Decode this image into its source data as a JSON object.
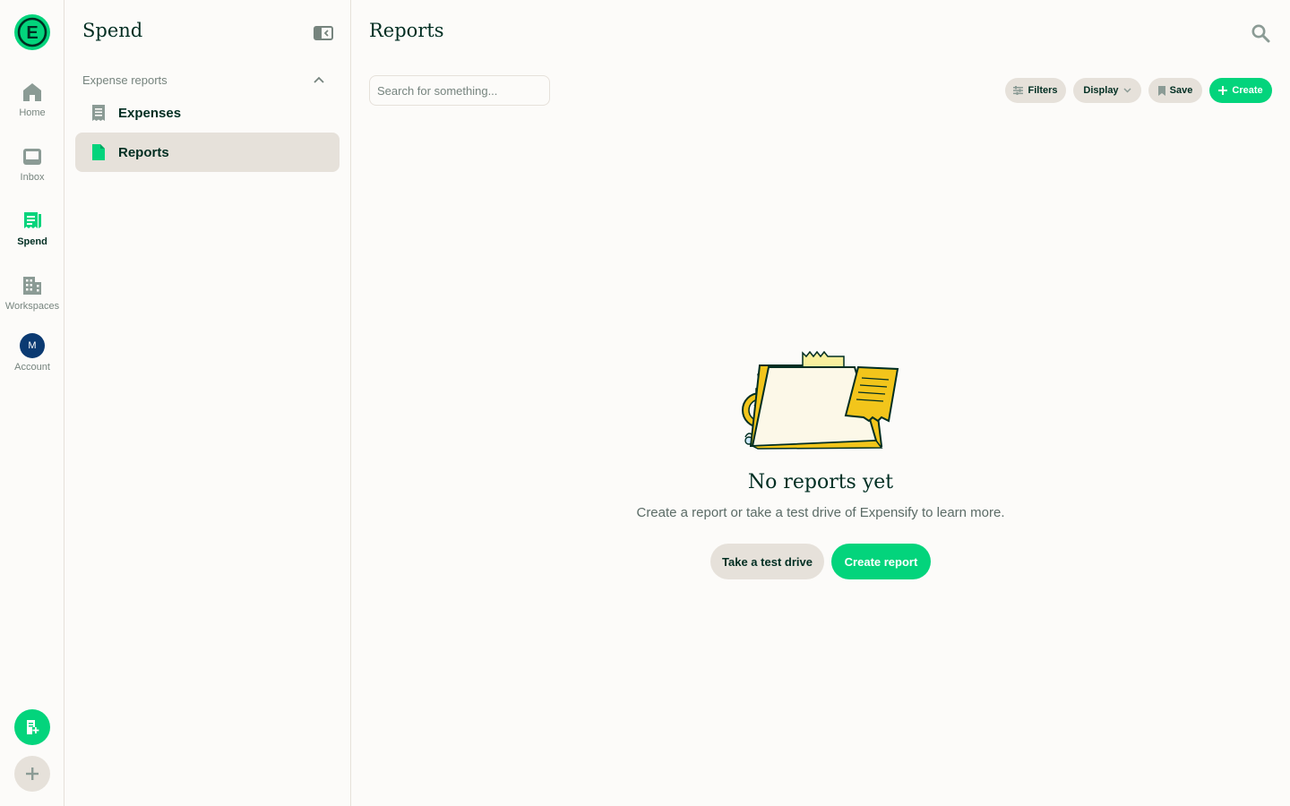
{
  "colors": {
    "brand_green": "#03d47c",
    "text_dark": "#002e22",
    "muted": "#76847e",
    "pill_bg": "#e6e1da",
    "background": "#fcfbf9",
    "avatar_blue": "#0b3a72"
  },
  "rail": {
    "logo_letter": "E",
    "items": [
      {
        "label": "Home",
        "icon": "home-icon"
      },
      {
        "label": "Inbox",
        "icon": "inbox-icon"
      },
      {
        "label": "Spend",
        "icon": "receipt-icon"
      },
      {
        "label": "Workspaces",
        "icon": "building-icon"
      },
      {
        "label": "Account",
        "icon": "avatar"
      }
    ],
    "avatar_initial": "M",
    "active": "Spend"
  },
  "sidebar": {
    "title": "Spend",
    "section_label": "Expense reports",
    "items": [
      {
        "label": "Expenses",
        "icon": "receipt-list-icon"
      },
      {
        "label": "Reports",
        "icon": "document-icon"
      }
    ],
    "active_item": "Reports"
  },
  "main": {
    "title": "Reports",
    "search_placeholder": "Search for something...",
    "toolbar": {
      "filters_label": "Filters",
      "display_label": "Display",
      "save_label": "Save",
      "create_label": "Create"
    },
    "empty": {
      "title": "No reports yet",
      "subtitle": "Create a report or take a test drive of Expensify to learn more.",
      "secondary_button": "Take a test drive",
      "primary_button": "Create report"
    }
  }
}
